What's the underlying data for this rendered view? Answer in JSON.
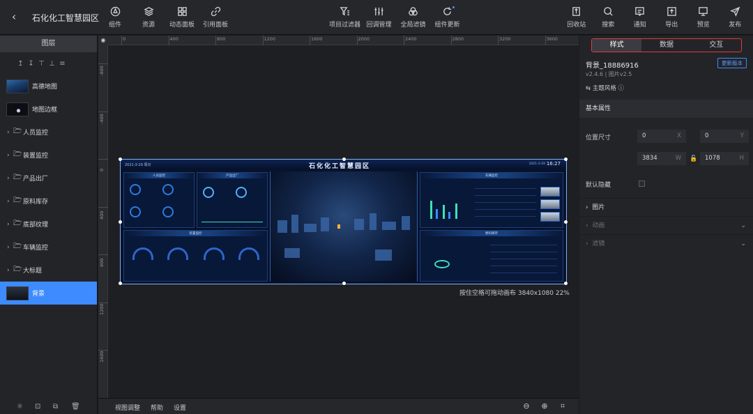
{
  "app": {
    "title": "石化化工智慧园区",
    "back_icon": "chevron-left-icon"
  },
  "toolbar": {
    "left": [
      {
        "label": "组件",
        "icon": "component-icon"
      },
      {
        "label": "资源",
        "icon": "layers-icon"
      },
      {
        "label": "动态面板",
        "icon": "grid-panel-icon"
      },
      {
        "label": "引用面板",
        "icon": "link-icon"
      }
    ],
    "center": [
      {
        "label": "项目过滤器",
        "icon": "filter-icon"
      },
      {
        "label": "回调管理",
        "icon": "sliders-icon"
      },
      {
        "label": "全局滤镜",
        "icon": "color-circles-icon"
      },
      {
        "label": "组件更新",
        "icon": "refresh-icon"
      }
    ],
    "right": [
      {
        "label": "回收站",
        "icon": "trash-bin-icon"
      },
      {
        "label": "搜索",
        "icon": "search-icon"
      },
      {
        "label": "通知",
        "icon": "message-icon"
      },
      {
        "label": "导出",
        "icon": "export-icon"
      },
      {
        "label": "预览",
        "icon": "monitor-icon"
      },
      {
        "label": "发布",
        "icon": "send-icon"
      }
    ]
  },
  "layers_panel": {
    "title": "图层",
    "tools": [
      "↥",
      "↧",
      "⊤",
      "⊥",
      "≡"
    ],
    "items": [
      {
        "label": "高德地图",
        "type": "component",
        "thumb": "map"
      },
      {
        "label": "地图边框",
        "type": "component",
        "thumb": "frame"
      },
      {
        "label": "人员监控",
        "type": "group"
      },
      {
        "label": "装置监控",
        "type": "group"
      },
      {
        "label": "产品出厂",
        "type": "group"
      },
      {
        "label": "原料库存",
        "type": "group"
      },
      {
        "label": "底部纹理",
        "type": "group"
      },
      {
        "label": "车辆监控",
        "type": "group"
      },
      {
        "label": "大标题",
        "type": "group"
      },
      {
        "label": "背景",
        "type": "component",
        "thumb": "bg",
        "selected": true
      }
    ],
    "footer_icons": [
      "lightbulb-icon",
      "lock-icon",
      "copy-icon",
      "delete-icon"
    ]
  },
  "canvas": {
    "ruler_h": [
      "0",
      "400",
      "800",
      "1200",
      "1600",
      "2000",
      "2400",
      "2800",
      "3200",
      "3600"
    ],
    "ruler_v": [
      "-800",
      "-400",
      "0",
      "400",
      "800",
      "1200",
      "1600",
      "2000"
    ],
    "hint": "按住空格可拖动画布  3840x1080 22%",
    "dashboard": {
      "title": "石化化工智慧园区",
      "top_left": "2021-3-29   周日",
      "time": "16:27",
      "date": "2021-3-29",
      "panels": [
        "人员监控",
        "产品出厂",
        "装置监控",
        "车辆监控",
        "原料库存"
      ]
    }
  },
  "bottom_bar": {
    "items": [
      "视图调整",
      "帮助",
      "设置"
    ],
    "icons": [
      "zoom-out-icon",
      "zoom-in-icon",
      "fit-screen-icon"
    ]
  },
  "props": {
    "tabs": [
      {
        "label": "样式",
        "active": true
      },
      {
        "label": "数据",
        "active": false
      },
      {
        "label": "交互",
        "active": false
      }
    ],
    "component_name": "背景_18886916",
    "version": "v2.4.6 | 图片v2.5",
    "update_button": "更新版本",
    "theme": "⇆ 主题风格 ⓘ",
    "section": "基本属性",
    "size_label": "位置尺寸",
    "x": {
      "value": "0",
      "suffix": "X"
    },
    "y": {
      "value": "0",
      "suffix": "Y"
    },
    "w": {
      "value": "3834",
      "suffix": "W"
    },
    "h": {
      "value": "1078",
      "suffix": "H"
    },
    "hide_label": "默认隐藏",
    "collapsibles": [
      {
        "label": "图片",
        "dim": false
      },
      {
        "label": "动画",
        "dim": true
      },
      {
        "label": "滤镜",
        "dim": true
      }
    ]
  }
}
